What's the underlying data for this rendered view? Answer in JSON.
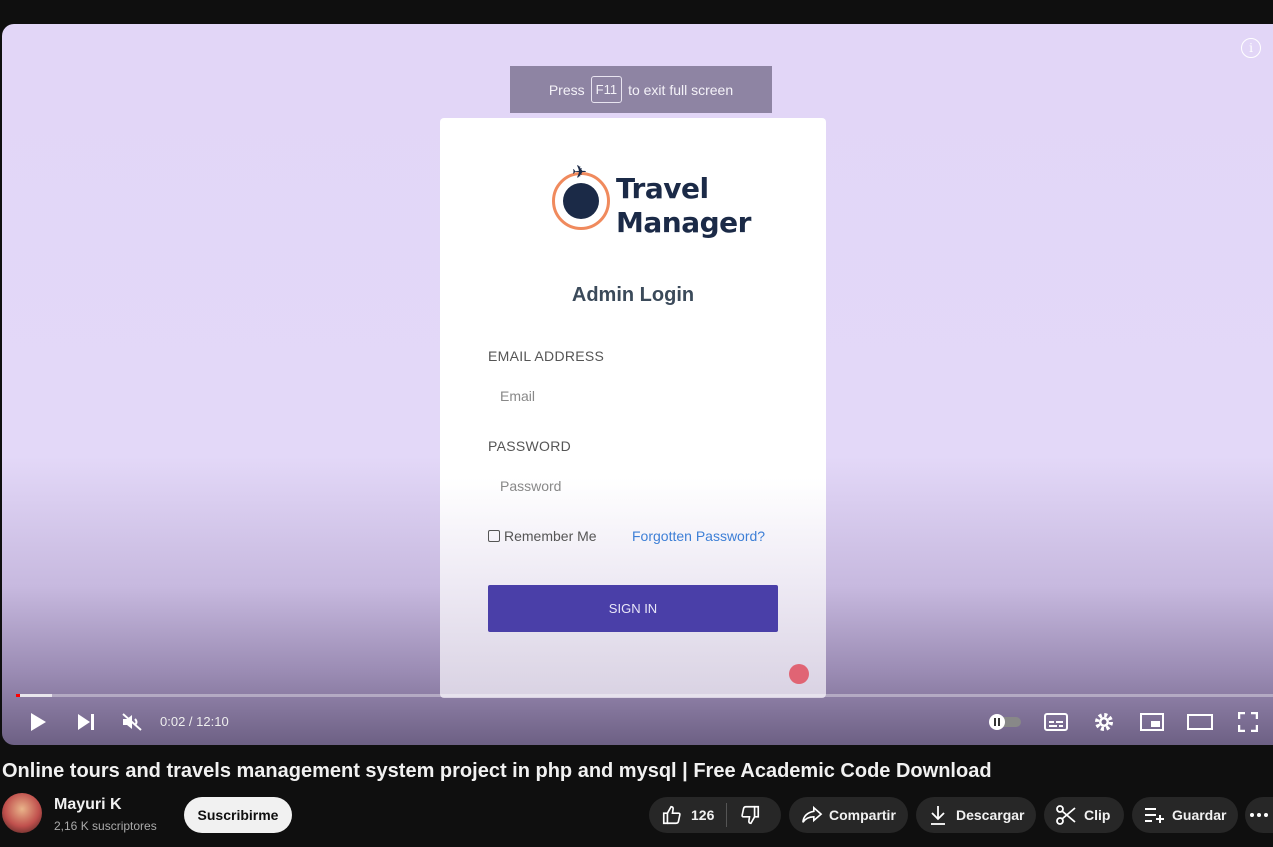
{
  "player": {
    "fullscreen_hint": {
      "prefix": "Press",
      "key": "F11",
      "suffix": "to exit full screen"
    },
    "login": {
      "brand_line1": "Travel",
      "brand_line2": "Manager",
      "heading": "Admin Login",
      "email_label": "EMAIL ADDRESS",
      "email_placeholder": "Email",
      "password_label": "PASSWORD",
      "password_placeholder": "Password",
      "remember": "Remember Me",
      "forgot": "Forgotten Password?",
      "sign_in": "SIGN IN"
    },
    "time": "0:02 / 12:10",
    "progress_fraction": 0.003,
    "buffer_fraction": 0.029
  },
  "video": {
    "title": "Online tours and travels management system project in php and mysql | Free Academic Code Download"
  },
  "channel": {
    "name": "Mayuri K",
    "subscribers": "2,16 K suscriptores",
    "subscribe_label": "Suscribirme"
  },
  "actions": {
    "likes": "126",
    "share": "Compartir",
    "download": "Descargar",
    "clip": "Clip",
    "save": "Guardar"
  }
}
